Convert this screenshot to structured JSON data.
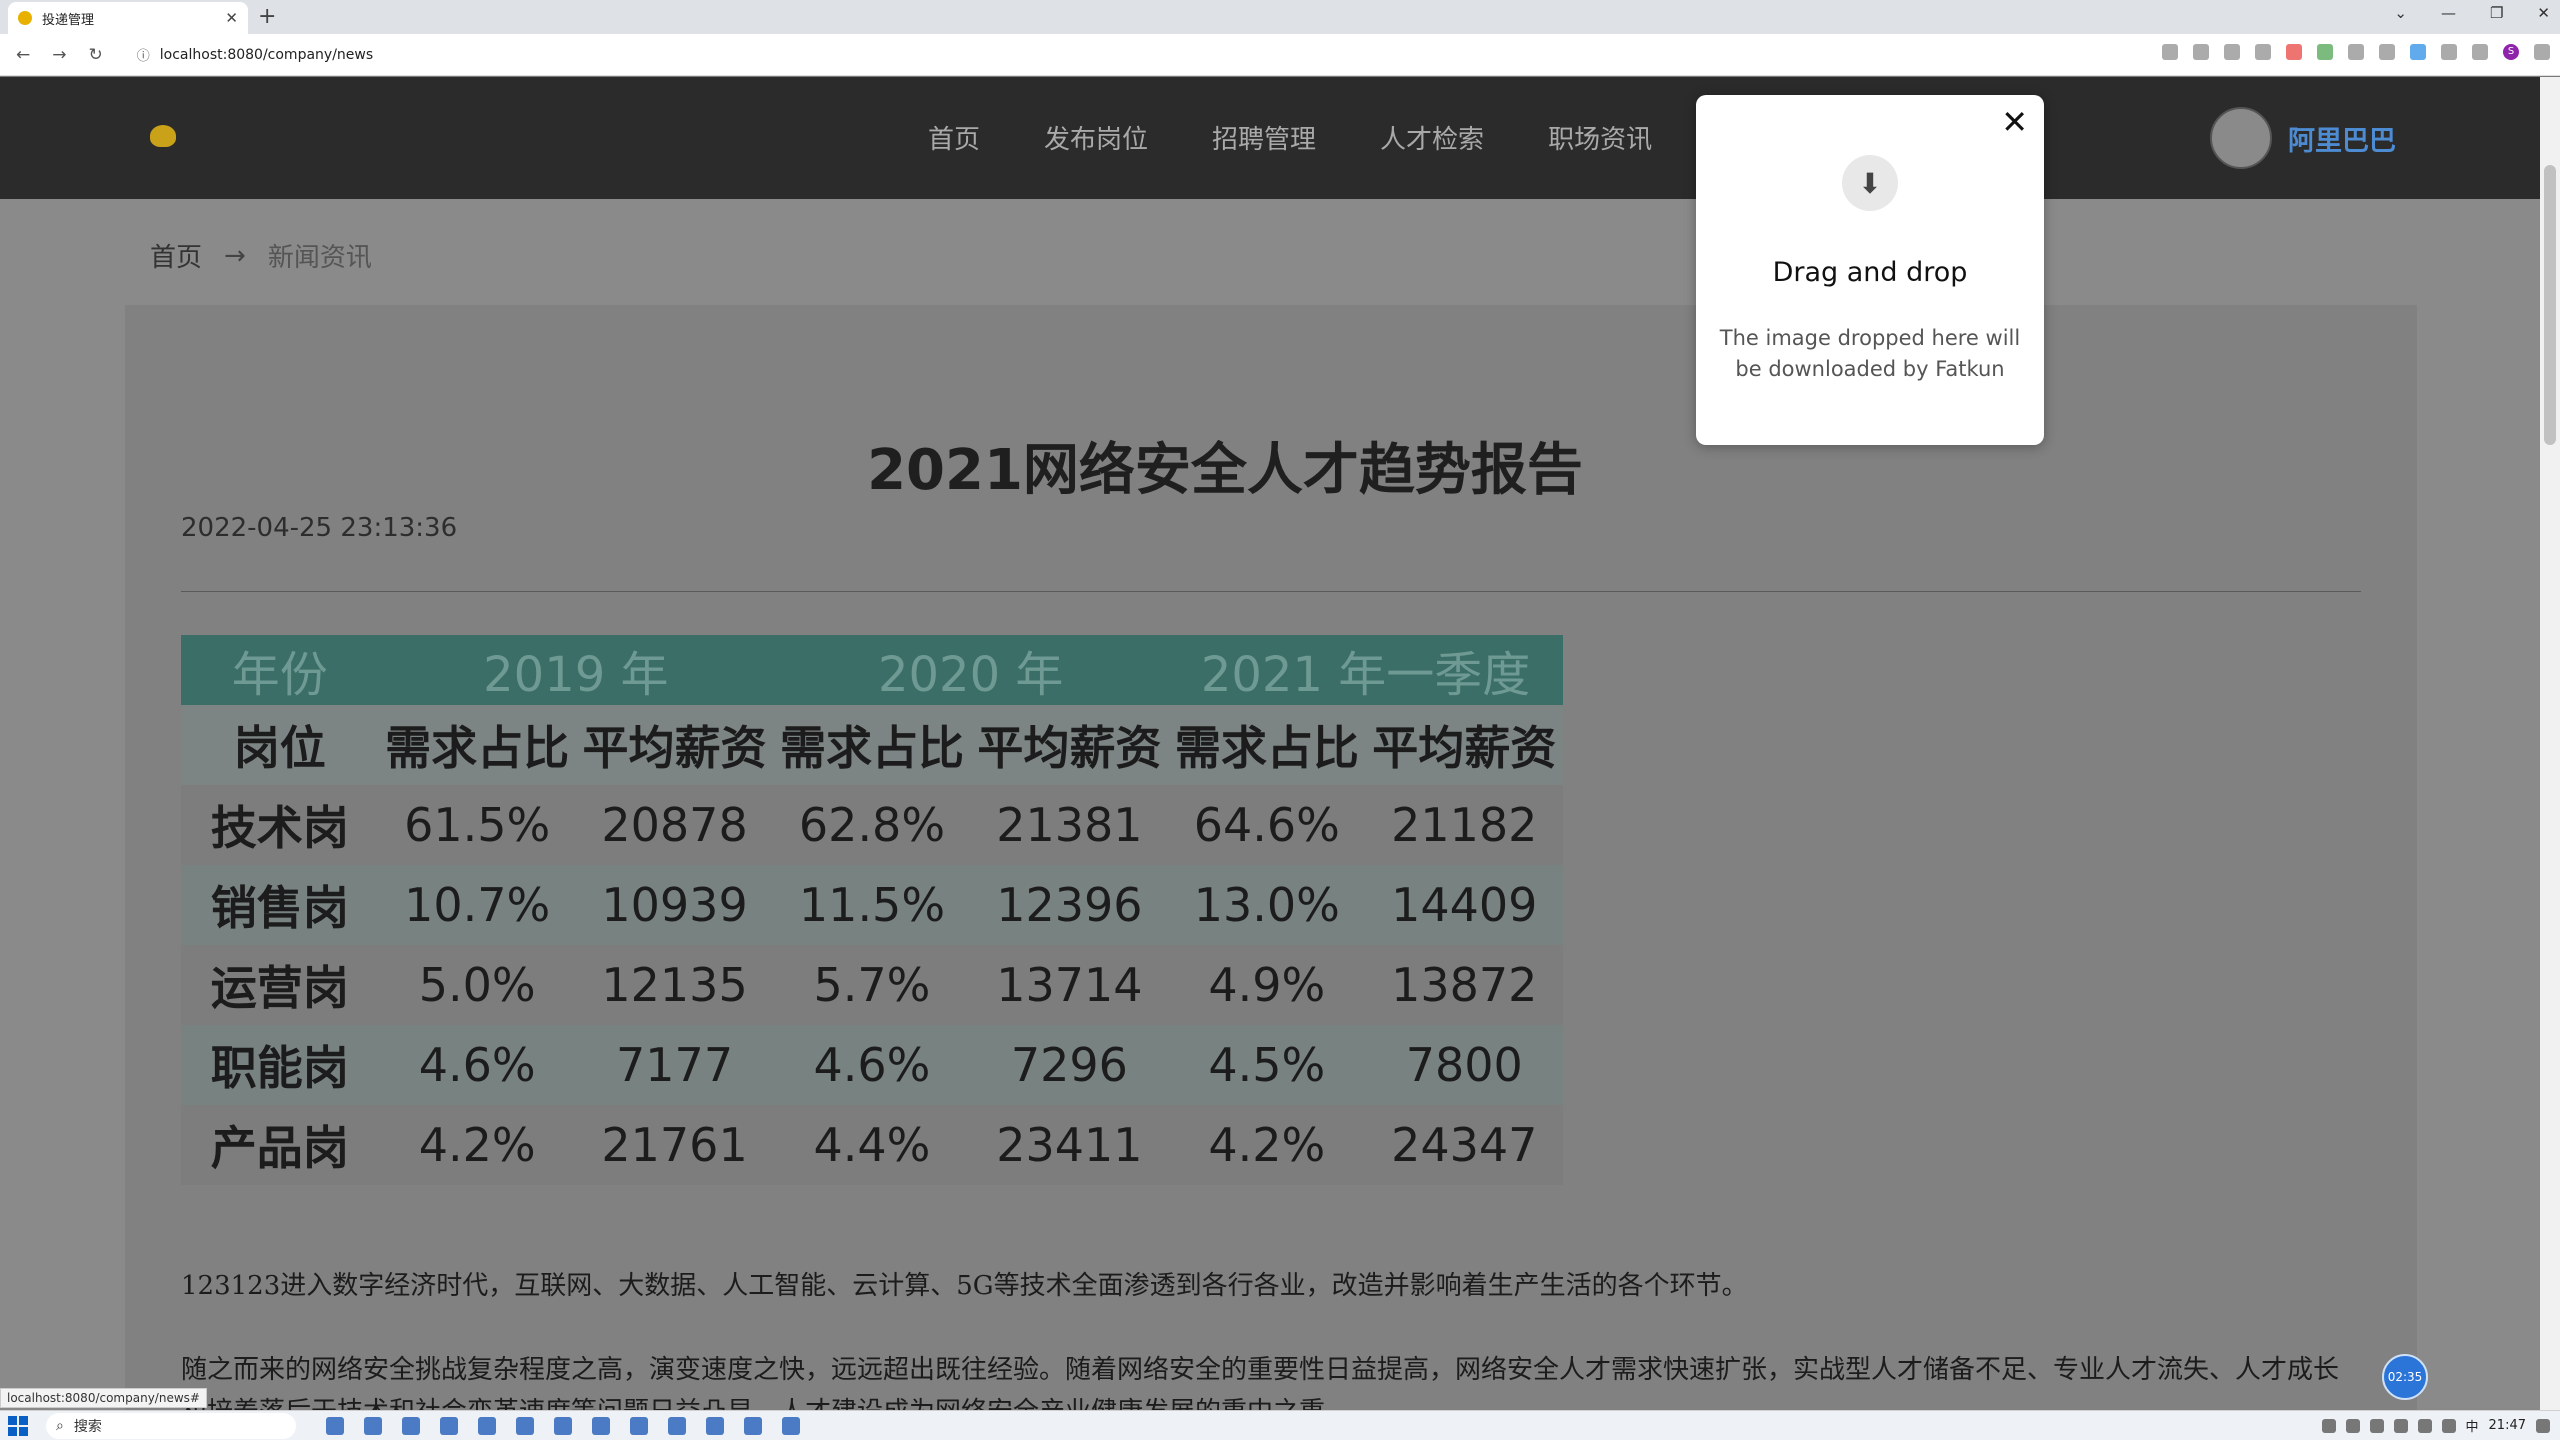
{
  "browser": {
    "tab_title": "投递管理",
    "new_tab": "+",
    "url": "localhost:8080/company/news",
    "status_url": "localhost:8080/company/news#"
  },
  "header": {
    "nav": [
      "首页",
      "发布岗位",
      "招聘管理",
      "人才检索",
      "职场资讯"
    ],
    "username": "阿里巴巴"
  },
  "breadcrumb": {
    "home": "首页",
    "separator": "→",
    "current": "新闻资讯"
  },
  "article": {
    "title": "2021网络安全人才趋势报告",
    "date": "2022-04-25 23:13:36",
    "table": {
      "year_row": [
        "年份",
        "2019 年",
        "2020 年",
        "2021 年一季度"
      ],
      "header_row": [
        "岗位",
        "需求占比",
        "平均薪资",
        "需求占比",
        "平均薪资",
        "需求占比",
        "平均薪资"
      ],
      "rows": [
        [
          "技术岗",
          "61.5%",
          "20878",
          "62.8%",
          "21381",
          "64.6%",
          "21182"
        ],
        [
          "销售岗",
          "10.7%",
          "10939",
          "11.5%",
          "12396",
          "13.0%",
          "14409"
        ],
        [
          "运营岗",
          "5.0%",
          "12135",
          "5.7%",
          "13714",
          "4.9%",
          "13872"
        ],
        [
          "职能岗",
          "4.6%",
          "7177",
          "4.6%",
          "7296",
          "4.5%",
          "7800"
        ],
        [
          "产品岗",
          "4.2%",
          "21761",
          "4.4%",
          "23411",
          "4.2%",
          "24347"
        ]
      ]
    },
    "para1": "123123进入数字经济时代，互联网、大数据、人工智能、云计算、5G等技术全面渗透到各行各业，改造并影响着生产生活的各个环节。",
    "para2": "随之而来的网络安全挑战复杂程度之高，演变速度之快，远远超出既往经验。随着网络安全的重要性日益提高，网络安全人才需求快速扩张，实战型人才储备不足、专业人才流失、人才成长和培养落后于技术和社会变革速度等问题日益凸显，人才建设成为网络安全产业健康发展的重中之重。"
  },
  "popup": {
    "close": "✕",
    "title": "Drag and drop",
    "description": "The image dropped here will be downloaded by Fatkun"
  },
  "timer": "02:35",
  "taskbar": {
    "search": "搜索",
    "time": "21:47",
    "ime": "中"
  }
}
